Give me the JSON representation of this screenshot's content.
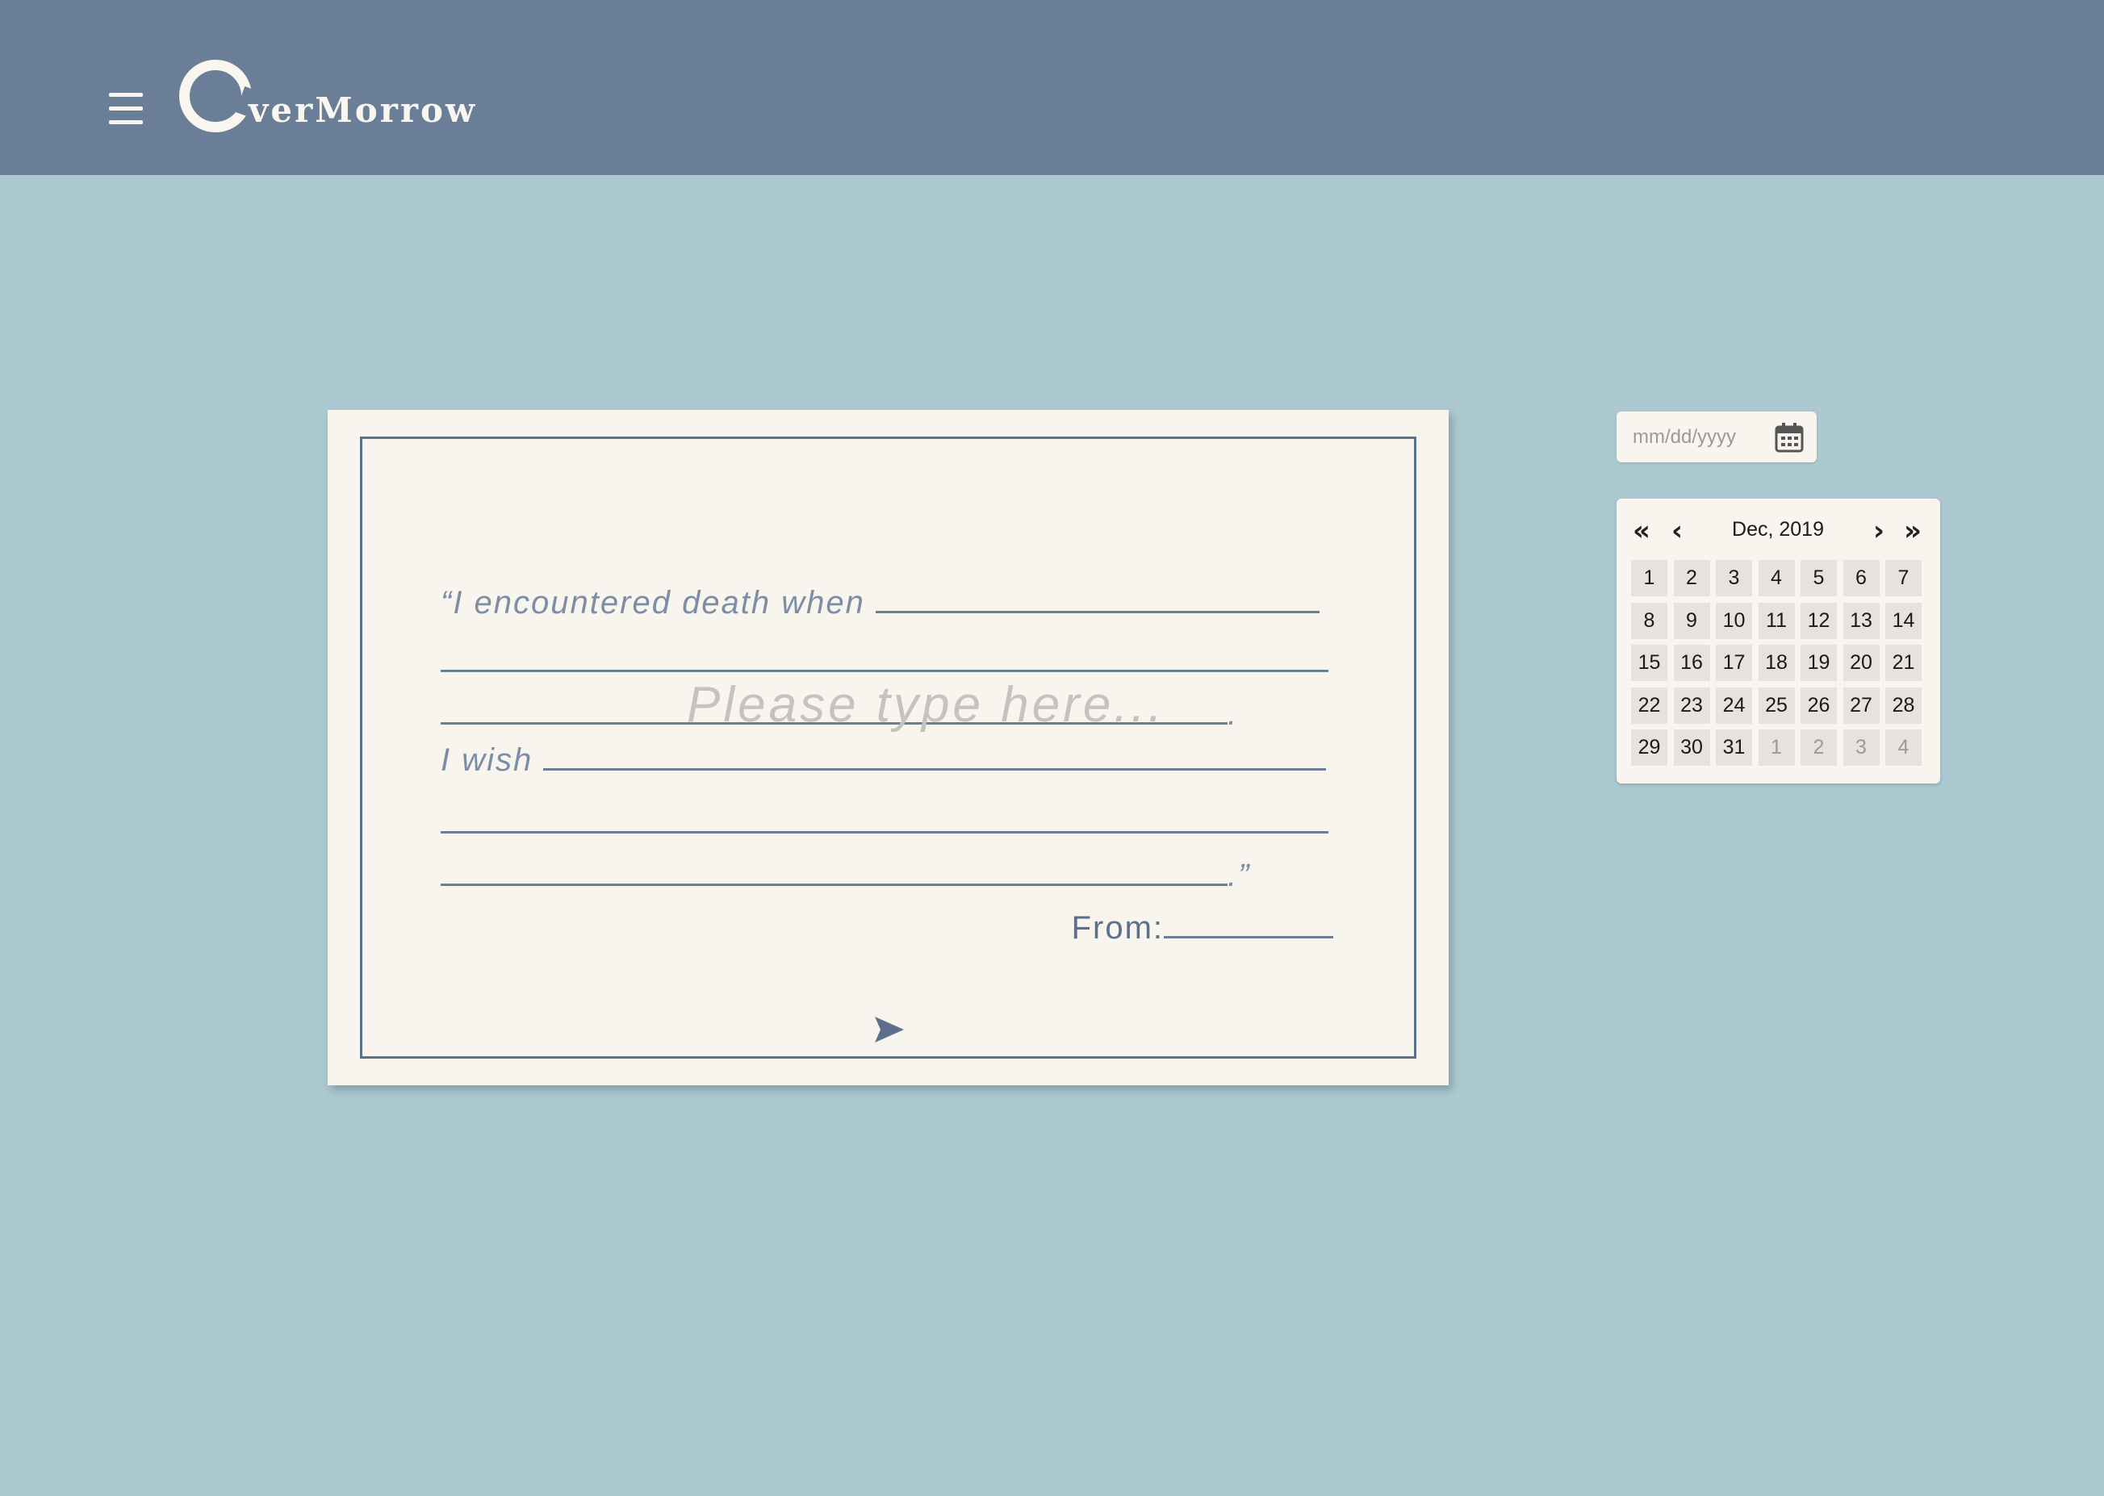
{
  "header": {
    "logo_text": "verMorrow"
  },
  "card": {
    "line1_prefix": "“I encountered death when",
    "line3_suffix": ".",
    "line4_prefix": "I wish",
    "line6_suffix": ".”",
    "placeholder": "Please type here...",
    "from_label": "From:"
  },
  "date_input": {
    "placeholder": "mm/dd/yyyy"
  },
  "calendar": {
    "month_label": "Dec, 2019",
    "days": [
      {
        "label": "1",
        "muted": false
      },
      {
        "label": "2",
        "muted": false
      },
      {
        "label": "3",
        "muted": false
      },
      {
        "label": "4",
        "muted": false
      },
      {
        "label": "5",
        "muted": false
      },
      {
        "label": "6",
        "muted": false
      },
      {
        "label": "7",
        "muted": false
      },
      {
        "label": "8",
        "muted": false
      },
      {
        "label": "9",
        "muted": false
      },
      {
        "label": "10",
        "muted": false
      },
      {
        "label": "11",
        "muted": false
      },
      {
        "label": "12",
        "muted": false
      },
      {
        "label": "13",
        "muted": false
      },
      {
        "label": "14",
        "muted": false
      },
      {
        "label": "15",
        "muted": false
      },
      {
        "label": "16",
        "muted": false
      },
      {
        "label": "17",
        "muted": false
      },
      {
        "label": "18",
        "muted": false
      },
      {
        "label": "19",
        "muted": false
      },
      {
        "label": "20",
        "muted": false
      },
      {
        "label": "21",
        "muted": false
      },
      {
        "label": "22",
        "muted": false
      },
      {
        "label": "23",
        "muted": false
      },
      {
        "label": "24",
        "muted": false
      },
      {
        "label": "25",
        "muted": false
      },
      {
        "label": "26",
        "muted": false
      },
      {
        "label": "27",
        "muted": false
      },
      {
        "label": "28",
        "muted": false
      },
      {
        "label": "29",
        "muted": false
      },
      {
        "label": "30",
        "muted": false
      },
      {
        "label": "31",
        "muted": false
      },
      {
        "label": "1",
        "muted": true
      },
      {
        "label": "2",
        "muted": true
      },
      {
        "label": "3",
        "muted": true
      },
      {
        "label": "4",
        "muted": true
      }
    ]
  },
  "colors": {
    "header_bg": "#6a7f97",
    "page_bg": "#acc9d1",
    "card_bg": "#f8f5ee",
    "frame": "#5c6f8c"
  }
}
